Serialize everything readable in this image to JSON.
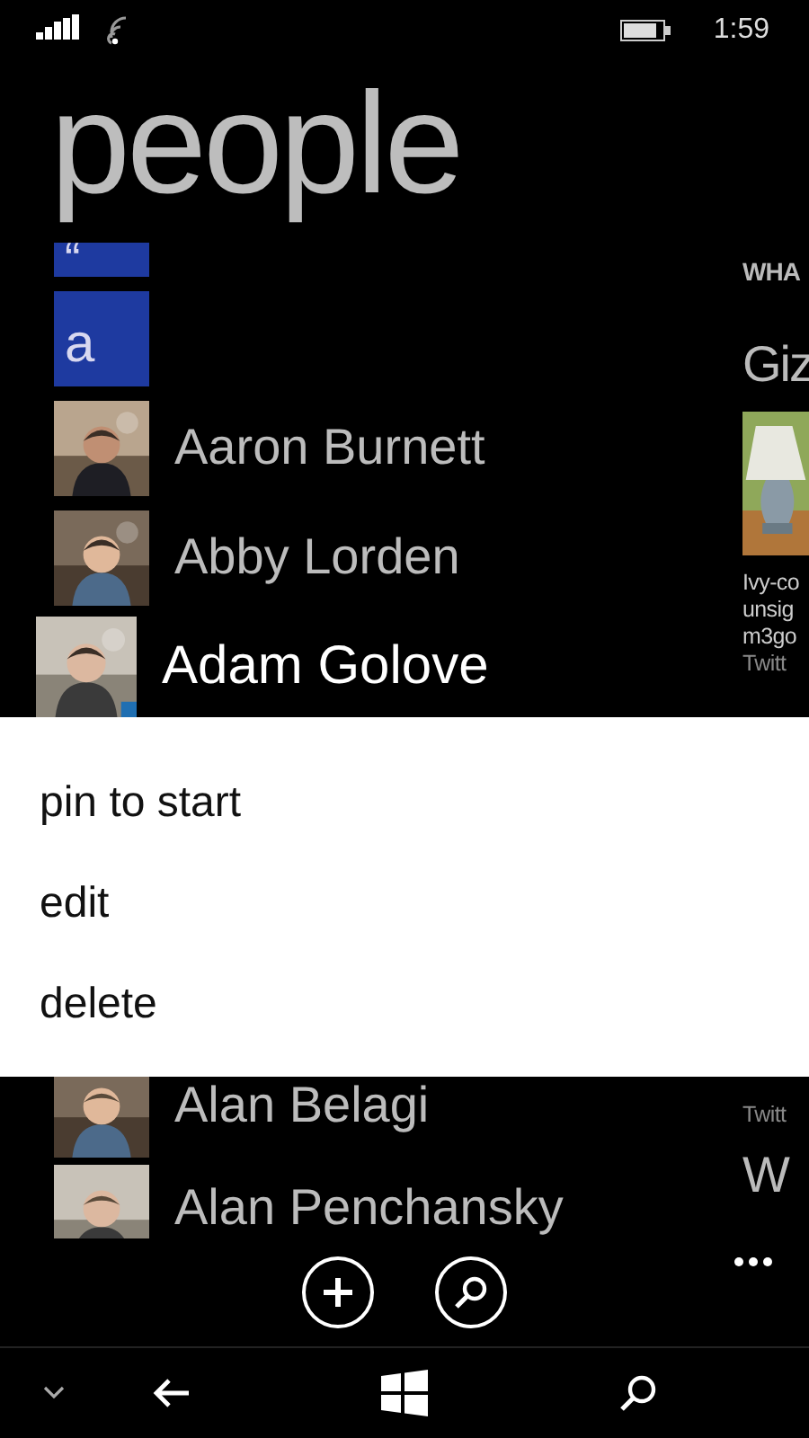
{
  "status_bar": {
    "time": "1:59"
  },
  "title": "people",
  "contacts": [
    {
      "kind": "letter",
      "label": "“"
    },
    {
      "kind": "letter",
      "label": "a"
    },
    {
      "kind": "person",
      "name": "Aaron Burnett",
      "pressed": false
    },
    {
      "kind": "person",
      "name": "Abby Lorden",
      "pressed": false
    },
    {
      "kind": "person",
      "name": "Adam Golove",
      "pressed": true
    }
  ],
  "whats_new": {
    "heading": "WHA",
    "author": "Giz",
    "lines": [
      "Ivy-co",
      "unsig",
      "m3go"
    ],
    "source": "Twitt"
  },
  "context_menu": {
    "items": [
      "pin to start",
      "edit",
      "delete"
    ]
  },
  "contacts_below_menu": [
    {
      "kind": "person",
      "name": "Alan Belagi",
      "pressed": false
    },
    {
      "kind": "person",
      "name": "Alan Penchansky",
      "pressed": false
    }
  ],
  "whats_new_below_menu": {
    "source": "Twitt",
    "author": "W"
  },
  "app_bar": {
    "buttons": [
      {
        "kind": "add"
      },
      {
        "kind": "search"
      }
    ]
  }
}
